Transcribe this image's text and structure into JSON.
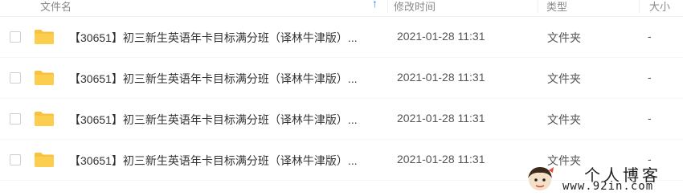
{
  "table": {
    "columns": {
      "name": "文件名",
      "modified": "修改时间",
      "type": "类型",
      "size": "大小"
    },
    "rows": [
      {
        "name": "【30651】初三新生英语年卡目标满分班（译林牛津版）...",
        "modified": "2021-01-28 11:31",
        "type": "文件夹",
        "size": "-"
      },
      {
        "name": "【30651】初三新生英语年卡目标满分班（译林牛津版）...",
        "modified": "2021-01-28 11:31",
        "type": "文件夹",
        "size": "-"
      },
      {
        "name": "【30651】初三新生英语年卡目标满分班（译林牛津版）...",
        "modified": "2021-01-28 11:31",
        "type": "文件夹",
        "size": "-"
      },
      {
        "name": "【30651】初三新生英语年卡目标满分班（译林牛津版）...",
        "modified": "2021-01-28 11:31",
        "type": "文件夹",
        "size": "-"
      }
    ]
  },
  "icons": {
    "folder": "folder-icon",
    "sort": "sort-arrow-icon",
    "folder_color": "#f9c23c"
  },
  "watermark": {
    "title": "个人博客",
    "url": "www.92in.com"
  }
}
